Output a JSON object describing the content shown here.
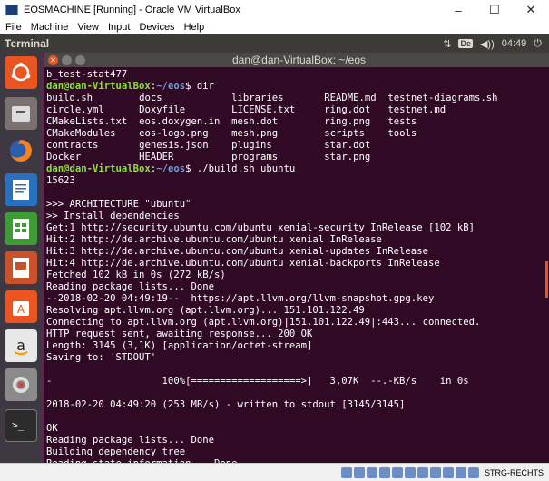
{
  "vbox": {
    "title": "EOSMACHINE [Running] - Oracle VM VirtualBox",
    "minimize": "–",
    "maximize": "☐",
    "close": "✕",
    "menu": [
      "File",
      "Machine",
      "View",
      "Input",
      "Devices",
      "Help"
    ],
    "host_key": "STRG-RECHTS"
  },
  "panel": {
    "app_name": "Terminal",
    "keyboard": "De",
    "volume": "◀))",
    "clock": "04:49",
    "power": "⏻",
    "network": "⇅"
  },
  "launcher": {
    "items": [
      "Ubuntu search",
      "Files",
      "Firefox",
      "LibreOffice Writer",
      "LibreOffice Calc",
      "LibreOffice Impress",
      "Ubuntu Software",
      "Amazon",
      "System Settings",
      "Terminal"
    ]
  },
  "terminal": {
    "title": "dan@dan-VirtualBox: ~/eos",
    "lines": [
      [
        {
          "t": "b_test-stat477",
          "c": ""
        }
      ],
      [
        {
          "t": "dan@dan-VirtualBox",
          "c": "prompt-user"
        },
        {
          "t": ":",
          "c": ""
        },
        {
          "t": "~/eos",
          "c": "prompt-path"
        },
        {
          "t": "$ dir",
          "c": ""
        }
      ],
      [
        {
          "t": "build.sh        ",
          "c": ""
        },
        {
          "t": "docs            ",
          "c": ""
        },
        {
          "t": "libraries       ",
          "c": ""
        },
        {
          "t": "README.md  ",
          "c": ""
        },
        {
          "t": "testnet-diagrams.sh",
          "c": ""
        }
      ],
      [
        {
          "t": "circle.yml      ",
          "c": ""
        },
        {
          "t": "Doxyfile        ",
          "c": ""
        },
        {
          "t": "LICENSE.txt     ",
          "c": ""
        },
        {
          "t": "ring.dot   ",
          "c": ""
        },
        {
          "t": "testnet.md",
          "c": ""
        }
      ],
      [
        {
          "t": "CMakeLists.txt  ",
          "c": ""
        },
        {
          "t": "eos.doxygen.in  ",
          "c": ""
        },
        {
          "t": "mesh.dot        ",
          "c": ""
        },
        {
          "t": "ring.png   ",
          "c": ""
        },
        {
          "t": "tests",
          "c": ""
        }
      ],
      [
        {
          "t": "CMakeModules    ",
          "c": ""
        },
        {
          "t": "eos-logo.png    ",
          "c": ""
        },
        {
          "t": "mesh.png        ",
          "c": ""
        },
        {
          "t": "scripts    ",
          "c": ""
        },
        {
          "t": "tools",
          "c": ""
        }
      ],
      [
        {
          "t": "contracts       ",
          "c": ""
        },
        {
          "t": "genesis.json    ",
          "c": ""
        },
        {
          "t": "plugins         ",
          "c": ""
        },
        {
          "t": "star.dot",
          "c": ""
        }
      ],
      [
        {
          "t": "Docker          ",
          "c": ""
        },
        {
          "t": "HEADER          ",
          "c": ""
        },
        {
          "t": "programs        ",
          "c": ""
        },
        {
          "t": "star.png",
          "c": ""
        }
      ],
      [
        {
          "t": "dan@dan-VirtualBox",
          "c": "prompt-user"
        },
        {
          "t": ":",
          "c": ""
        },
        {
          "t": "~/eos",
          "c": "prompt-path"
        },
        {
          "t": "$ ./build.sh ubuntu",
          "c": ""
        }
      ],
      [
        {
          "t": "15623",
          "c": ""
        }
      ],
      [
        {
          "t": "",
          "c": ""
        }
      ],
      [
        {
          "t": ">>> ARCHITECTURE \"ubuntu\"",
          "c": ""
        }
      ],
      [
        {
          "t": ">> Install dependencies",
          "c": ""
        }
      ],
      [
        {
          "t": "Get:1 http://security.ubuntu.com/ubuntu xenial-security InRelease [102 kB]",
          "c": ""
        }
      ],
      [
        {
          "t": "Hit:2 http://de.archive.ubuntu.com/ubuntu xenial InRelease",
          "c": ""
        }
      ],
      [
        {
          "t": "Hit:3 http://de.archive.ubuntu.com/ubuntu xenial-updates InRelease",
          "c": ""
        }
      ],
      [
        {
          "t": "Hit:4 http://de.archive.ubuntu.com/ubuntu xenial-backports InRelease",
          "c": ""
        }
      ],
      [
        {
          "t": "Fetched 102 kB in 0s (272 kB/s)",
          "c": ""
        }
      ],
      [
        {
          "t": "Reading package lists... Done",
          "c": ""
        }
      ],
      [
        {
          "t": "--2018-02-20 04:49:19--  https://apt.llvm.org/llvm-snapshot.gpg.key",
          "c": ""
        }
      ],
      [
        {
          "t": "Resolving apt.llvm.org (apt.llvm.org)... 151.101.122.49",
          "c": ""
        }
      ],
      [
        {
          "t": "Connecting to apt.llvm.org (apt.llvm.org)|151.101.122.49|:443... connected.",
          "c": ""
        }
      ],
      [
        {
          "t": "HTTP request sent, awaiting response... 200 OK",
          "c": ""
        }
      ],
      [
        {
          "t": "Length: 3145 (3,1K) [application/octet-stream]",
          "c": ""
        }
      ],
      [
        {
          "t": "Saving to: 'STDOUT'",
          "c": ""
        }
      ],
      [
        {
          "t": "",
          "c": ""
        }
      ],
      [
        {
          "t": "-                   100%[===================>]   3,07K  --.-KB/s    in 0s",
          "c": ""
        }
      ],
      [
        {
          "t": "",
          "c": ""
        }
      ],
      [
        {
          "t": "2018-02-20 04:49:20 (253 MB/s) - written to stdout [3145/3145]",
          "c": ""
        }
      ],
      [
        {
          "t": "",
          "c": ""
        }
      ],
      [
        {
          "t": "OK",
          "c": ""
        }
      ],
      [
        {
          "t": "Reading package lists... Done",
          "c": ""
        }
      ],
      [
        {
          "t": "Building dependency tree",
          "c": ""
        }
      ],
      [
        {
          "t": "Reading state information... Done",
          "c": ""
        }
      ]
    ]
  },
  "colors": {
    "terminal_bg": "#300a24",
    "desktop_bg": "#5e2750",
    "launcher_bg": "#3d3841",
    "panel_bg": "#3c3b37",
    "prompt_user": "#8ae234",
    "prompt_path": "#729fcf",
    "close_btn": "#e95420"
  }
}
